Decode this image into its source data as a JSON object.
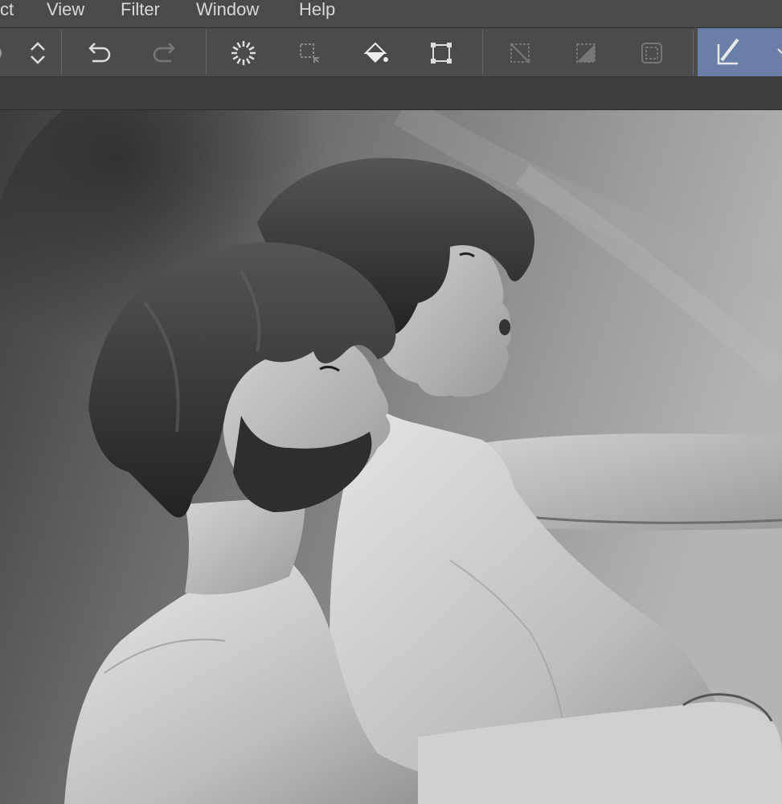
{
  "menubar": {
    "items": [
      {
        "label": "ct"
      },
      {
        "label": "View"
      },
      {
        "label": "Filter"
      },
      {
        "label": "Window"
      },
      {
        "label": "Help"
      }
    ]
  },
  "toolbar": {
    "icons": [
      "stepper-updown-icon",
      "undo-icon",
      "redo-icon",
      "loading-spinner-icon",
      "selection-launcher-icon",
      "fill-bucket-icon",
      "transform-icon",
      "deselect-icon",
      "invert-selection-icon",
      "selection-border-icon",
      "pen-selection-icon"
    ],
    "active_color": "#6a7fa8"
  },
  "canvas": {
    "content": "grayscale painting"
  }
}
